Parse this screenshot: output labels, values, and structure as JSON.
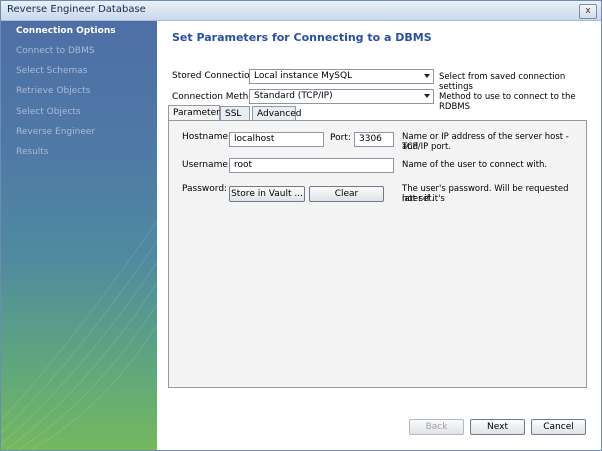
{
  "window": {
    "title": "Reverse Engineer Database",
    "close_glyph": "x"
  },
  "sidebar": {
    "steps": [
      {
        "label": "Connection Options",
        "active": true
      },
      {
        "label": "Connect to DBMS",
        "active": false
      },
      {
        "label": "Select Schemas",
        "active": false
      },
      {
        "label": "Retrieve Objects",
        "active": false
      },
      {
        "label": "Select Objects",
        "active": false
      },
      {
        "label": "Reverse Engineer",
        "active": false
      },
      {
        "label": "Results",
        "active": false
      }
    ]
  },
  "main": {
    "heading": "Set Parameters for Connecting to a DBMS",
    "stored_connection": {
      "label": "Stored Connection:",
      "value": "Local instance MySQL",
      "hint": "Select from saved connection settings"
    },
    "connection_method": {
      "label": "Connection Method:",
      "value": "Standard (TCP/IP)",
      "hint": "Method to use to connect to the RDBMS"
    },
    "tabs": [
      "Parameters",
      "SSL",
      "Advanced"
    ],
    "parameters": {
      "hostname_label": "Hostname:",
      "hostname_value": "localhost",
      "port_label": "Port:",
      "port_value": "3306",
      "hostname_hint_1": "Name or IP address of the server host - and",
      "hostname_hint_2": "TCP/IP port.",
      "username_label": "Username:",
      "username_value": "root",
      "username_hint": "Name of the user to connect with.",
      "password_label": "Password:",
      "store_vault_label": "Store in Vault ...",
      "clear_label": "Clear",
      "password_hint_1": "The user's password. Will be requested later if it's",
      "password_hint_2": "not set."
    }
  },
  "footer": {
    "back_label": "Back",
    "next_label": "Next",
    "cancel_label": "Cancel"
  }
}
